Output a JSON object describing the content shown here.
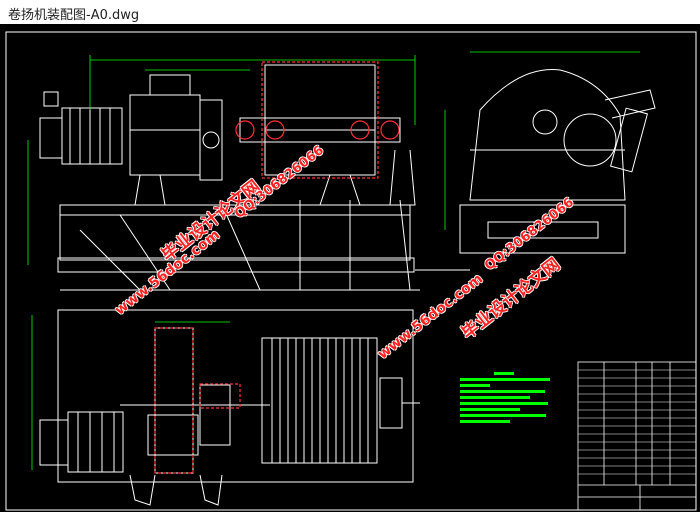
{
  "window": {
    "title": "卷扬机装配图-A0.dwg"
  },
  "watermarks": {
    "site_name": "毕业设计论文网",
    "url": "www.56doc.com",
    "qq": "QQ:306826066"
  },
  "colors": {
    "background": "#000000",
    "lines": "#ffffff",
    "dimensions": "#00ff00",
    "highlight": "#ff3030",
    "notes": "#00ff00",
    "watermark": "#ff2020"
  }
}
